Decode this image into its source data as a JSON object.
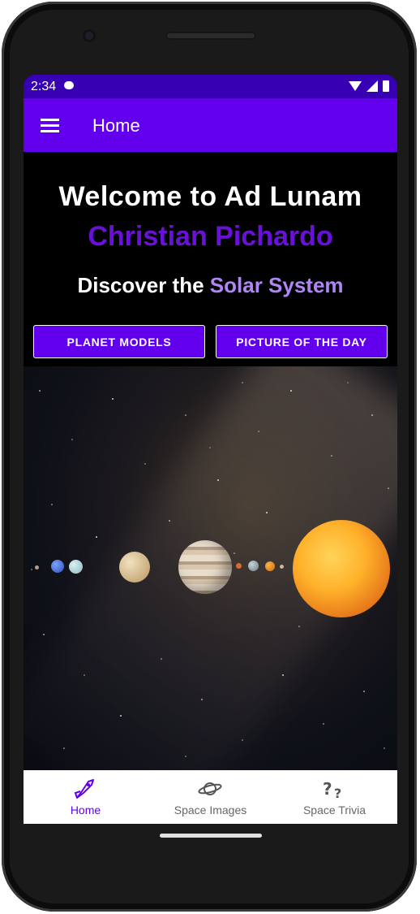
{
  "status_bar": {
    "time": "2:34"
  },
  "app_bar": {
    "title": "Home"
  },
  "welcome": {
    "line1": "Welcome to Ad Lunam",
    "user_name": "Christian Pichardo"
  },
  "discover": {
    "prefix": "Discover the",
    "highlight": "Solar System"
  },
  "buttons": {
    "planet_models": "PLANET MODELS",
    "picture_of_the_day": "PICTURE OF THE DAY"
  },
  "bottom_nav": {
    "items": [
      {
        "label": "Home",
        "icon": "rocket-icon",
        "selected": true
      },
      {
        "label": "Space Images",
        "icon": "planet-icon",
        "selected": false
      },
      {
        "label": "Space Trivia",
        "icon": "question-marks-icon",
        "selected": false
      }
    ]
  },
  "colors": {
    "status_bar": "#3700b3",
    "primary": "#6200ee",
    "accent_text": "#6a11d9",
    "highlight_text": "#b085f5"
  }
}
